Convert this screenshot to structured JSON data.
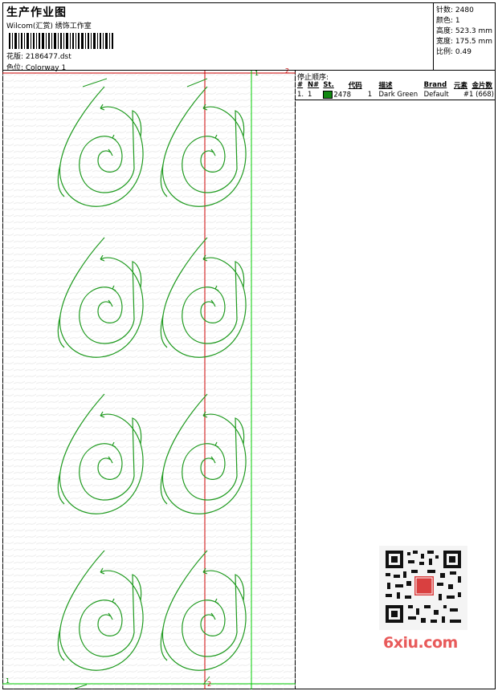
{
  "header": {
    "title": "生产作业图",
    "company": "Wilcom(汇赏) 绣饰工作室",
    "design_file": "花版: 2186477.dst",
    "colorway": "色位: Colorway 1"
  },
  "stats": [
    "针数: 2480",
    "颜色: 1",
    "高度: 523.3 mm",
    "宽度: 175.5 mm",
    "比例: 0.49"
  ],
  "stop_sequence": {
    "title": "停止顺序:",
    "headers": [
      "#",
      "N#",
      "St.",
      "代码",
      "描述",
      "Brand",
      "元素",
      "金片数"
    ],
    "rows": [
      {
        "num": "1.",
        "needle": "1",
        "code": "2478",
        "stops": "1",
        "desc": "Dark Green",
        "brand": "Default",
        "elements": "#1 (668)",
        "color": "#118811"
      }
    ]
  },
  "axis_labels": {
    "top_red": "2",
    "top_green": "1",
    "bottom_left": "1",
    "bottom_red": "2"
  },
  "watermark": {
    "text": "6xiu.com",
    "stamp": "绣花图"
  },
  "colors": {
    "stitch": "#1f9a1f",
    "guide_red": "#cc0000",
    "guide_green": "#00cc00"
  }
}
